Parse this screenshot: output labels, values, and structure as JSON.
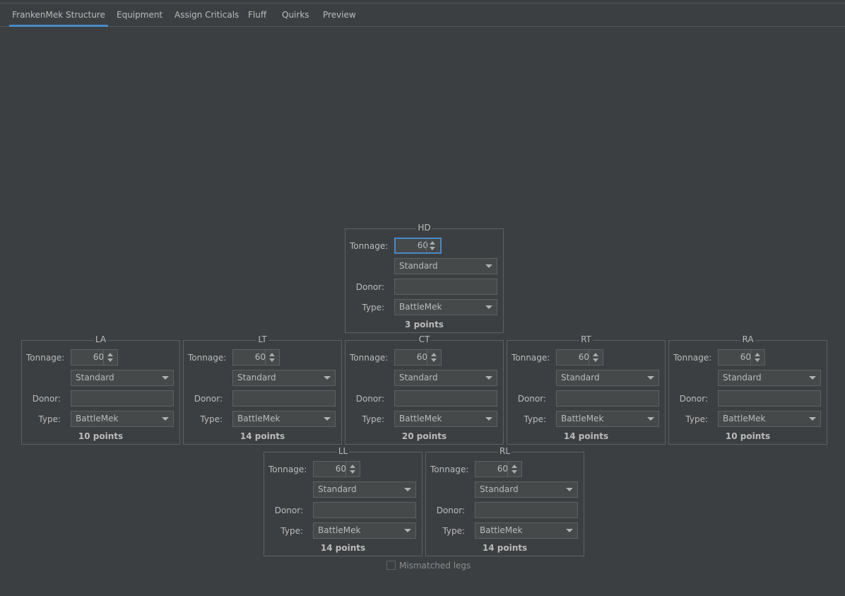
{
  "tabs": [
    {
      "label": "FrankenMek Structure",
      "active": true
    },
    {
      "label": "Equipment"
    },
    {
      "label": "Assign Criticals"
    },
    {
      "label": "Fluff"
    },
    {
      "label": "Quirks"
    },
    {
      "label": "Preview"
    }
  ],
  "labels": {
    "tonnage": "Tonnage:",
    "donor": "Donor:",
    "type": "Type:"
  },
  "panels": {
    "HD": {
      "title": "HD",
      "tonnage": "60",
      "structure": "Standard",
      "donor": "",
      "type": "BattleMek",
      "points": "3 points"
    },
    "LA": {
      "title": "LA",
      "tonnage": "60",
      "structure": "Standard",
      "donor": "",
      "type": "BattleMek",
      "points": "10 points"
    },
    "LT": {
      "title": "LT",
      "tonnage": "60",
      "structure": "Standard",
      "donor": "",
      "type": "BattleMek",
      "points": "14 points"
    },
    "CT": {
      "title": "CT",
      "tonnage": "60",
      "structure": "Standard",
      "donor": "",
      "type": "BattleMek",
      "points": "20 points"
    },
    "RT": {
      "title": "RT",
      "tonnage": "60",
      "structure": "Standard",
      "donor": "",
      "type": "BattleMek",
      "points": "14 points"
    },
    "RA": {
      "title": "RA",
      "tonnage": "60",
      "structure": "Standard",
      "donor": "",
      "type": "BattleMek",
      "points": "10 points"
    },
    "LL": {
      "title": "LL",
      "tonnage": "60",
      "structure": "Standard",
      "donor": "",
      "type": "BattleMek",
      "points": "14 points"
    },
    "RL": {
      "title": "RL",
      "tonnage": "60",
      "structure": "Standard",
      "donor": "",
      "type": "BattleMek",
      "points": "14 points"
    }
  },
  "mismatched_legs": {
    "label": "Mismatched legs",
    "checked": false,
    "enabled": false
  },
  "colors": {
    "background": "#3c3f41",
    "accent": "#4a88c7",
    "border": "#5e6060",
    "text": "#bbbbbb"
  }
}
